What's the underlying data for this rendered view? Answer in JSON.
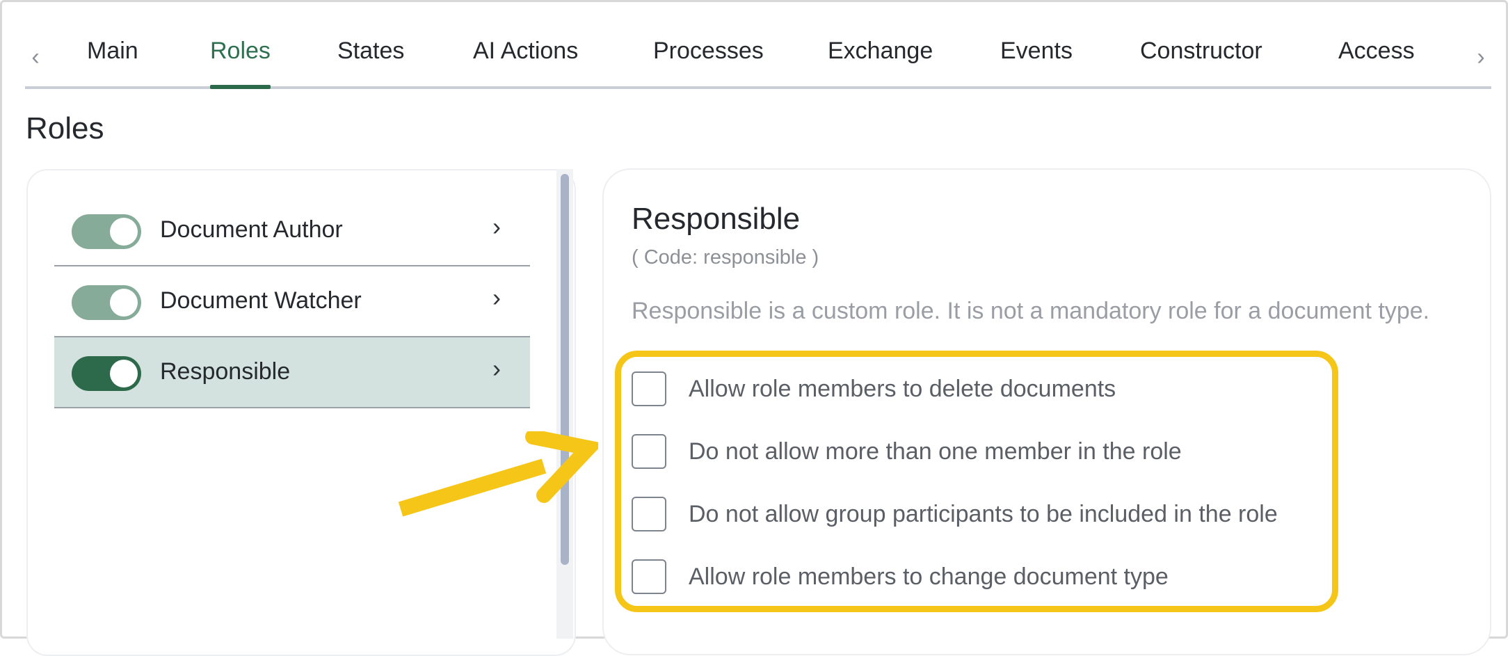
{
  "tabs": {
    "prev_icon": "chevron-left-icon",
    "next_icon": "chevron-right-icon",
    "items": [
      {
        "label": "Main",
        "active": false
      },
      {
        "label": "Roles",
        "active": true
      },
      {
        "label": "States",
        "active": false
      },
      {
        "label": "AI Actions",
        "active": false
      },
      {
        "label": "Processes",
        "active": false
      },
      {
        "label": "Exchange",
        "active": false
      },
      {
        "label": "Events",
        "active": false
      },
      {
        "label": "Constructor",
        "active": false
      },
      {
        "label": "Access",
        "active": false
      }
    ]
  },
  "page": {
    "title": "Roles"
  },
  "roles": {
    "items": [
      {
        "label": "Document Author",
        "enabled": true,
        "selected": false
      },
      {
        "label": "Document Watcher",
        "enabled": true,
        "selected": false
      },
      {
        "label": "Responsible",
        "enabled": true,
        "selected": true
      }
    ]
  },
  "detail": {
    "title": "Responsible",
    "code": "( Code: responsible )",
    "description": "Responsible is a custom role. It is not a mandatory role for a document type.",
    "options": [
      {
        "label": "Allow role members to delete documents",
        "checked": false
      },
      {
        "label": "Do not allow more than one member in the role",
        "checked": false
      },
      {
        "label": "Do not allow group participants to be included in the role",
        "checked": false
      },
      {
        "label": "Allow role members to change document type",
        "checked": false
      }
    ]
  },
  "colors": {
    "accent": "#2d6a4b",
    "highlight": "#f5c518",
    "selected_row": "#d3e2de"
  }
}
